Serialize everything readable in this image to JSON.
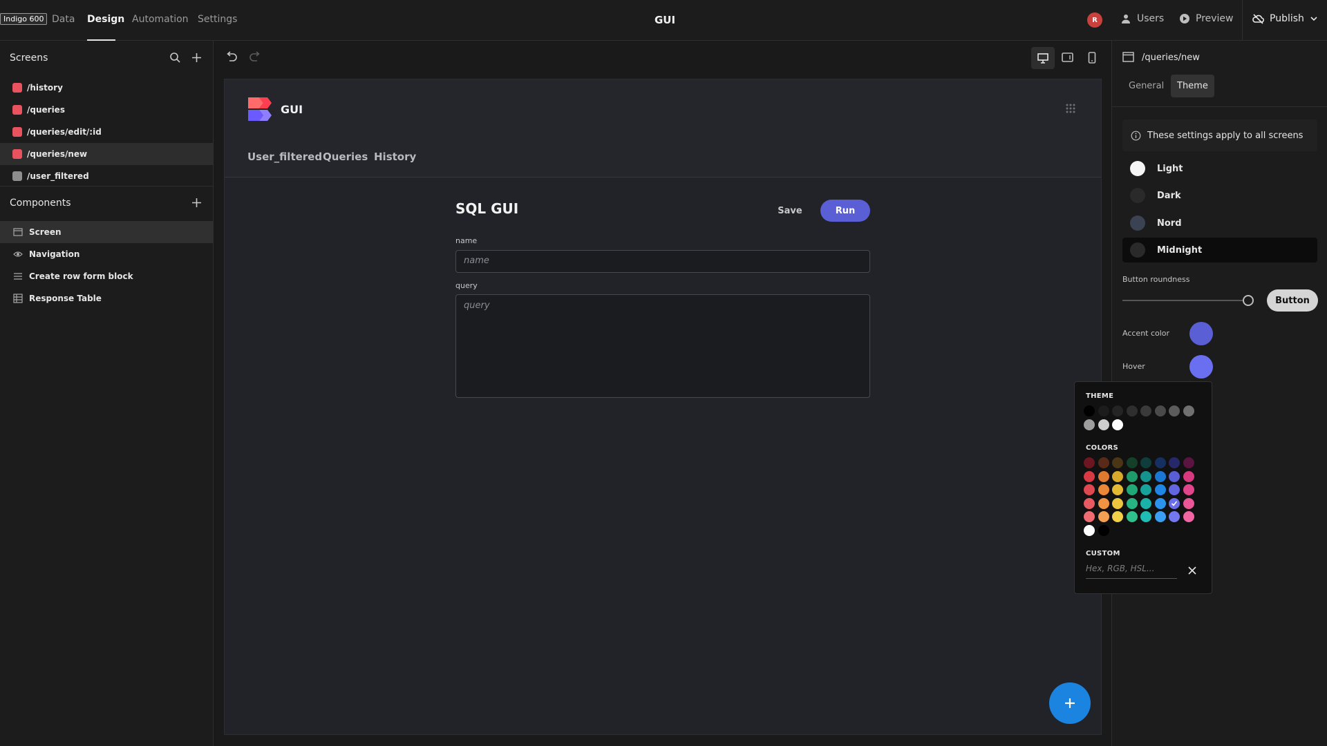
{
  "topbar": {
    "tooltip": "Indigo 600",
    "nav": [
      "Data",
      "Design",
      "Automation",
      "Settings"
    ],
    "app_title": "GUI",
    "avatar_initial": "R",
    "users_label": "Users",
    "preview_label": "Preview",
    "publish_label": "Publish"
  },
  "left": {
    "screens_title": "Screens",
    "screens": [
      {
        "label": "/history",
        "color": "#e8535f"
      },
      {
        "label": "/queries",
        "color": "#e8535f"
      },
      {
        "label": "/queries/edit/:id",
        "color": "#e8535f"
      },
      {
        "label": "/queries/new",
        "color": "#e8535f"
      },
      {
        "label": "/user_filtered",
        "color": "#8e8e8e"
      }
    ],
    "components_title": "Components",
    "components": [
      {
        "label": "Screen",
        "icon": "screen-icon"
      },
      {
        "label": "Navigation",
        "icon": "eye-icon"
      },
      {
        "label": "Create row form block",
        "icon": "form-icon"
      },
      {
        "label": "Response Table",
        "icon": "table-icon"
      }
    ]
  },
  "preview": {
    "brand_title": "GUI",
    "nav_links": [
      "User_filtered",
      "Queries",
      "History"
    ],
    "form_title": "SQL GUI",
    "save_label": "Save",
    "run_label": "Run",
    "name_label": "name",
    "name_placeholder": "name",
    "query_label": "query",
    "query_placeholder": "query"
  },
  "right": {
    "path": "/queries/new",
    "tabs": [
      "General",
      "Theme"
    ],
    "active_tab": "Theme",
    "info": "These settings apply to all screens",
    "themes": [
      {
        "label": "Light",
        "color": "#f5f5f5"
      },
      {
        "label": "Dark",
        "color": "#2a2a2a"
      },
      {
        "label": "Nord",
        "color": "#3b4252"
      },
      {
        "label": "Midnight",
        "color": "#2a2a2a"
      }
    ],
    "selected_theme": "Midnight",
    "button_roundness_label": "Button roundness",
    "button_roundness_value": 1.0,
    "button_preview_label": "Button",
    "accent_label": "Accent color",
    "accent_color": "#5b5fd6",
    "hover_label": "Hover",
    "hover_color": "#6a6ef0"
  },
  "picker": {
    "theme_heading": "THEME",
    "theme_colors": [
      "#000000",
      "#1c1c1c",
      "#242424",
      "#2e2e2e",
      "#3a3a3a",
      "#4a4a4a",
      "#5c5c5c",
      "#707070",
      "#9e9e9e",
      "#cfcfcf",
      "#ffffff"
    ],
    "colors_heading": "COLORS",
    "color_rows": [
      [
        "#6b1621",
        "#5a2a18",
        "#4a3514",
        "#14402a",
        "#0e3d3c",
        "#153060",
        "#26286a",
        "#5a1440"
      ],
      [
        "#d83a44",
        "#e07a2e",
        "#d8a92a",
        "#1f9a6a",
        "#15938e",
        "#1a78d4",
        "#5a5ed6",
        "#d6397e"
      ],
      [
        "#e04851",
        "#ea8838",
        "#e4ba34",
        "#22a876",
        "#17a39c",
        "#1f86e6",
        "#6266e0",
        "#e2458c"
      ],
      [
        "#e85a62",
        "#f09444",
        "#ecc53e",
        "#28b482",
        "#1ab1a8",
        "#2b92ee",
        "#6a6ee8",
        "#ea5698"
      ],
      [
        "#ee6c72",
        "#f4a052",
        "#f2d04a",
        "#30c08c",
        "#1fbdb4",
        "#3a9ef4",
        "#7478f0",
        "#f066a4"
      ],
      [
        "#ffffff",
        "#000000"
      ]
    ],
    "selected_color": "#6a6ee8",
    "custom_heading": "CUSTOM",
    "custom_placeholder": "Hex, RGB, HSL..."
  }
}
